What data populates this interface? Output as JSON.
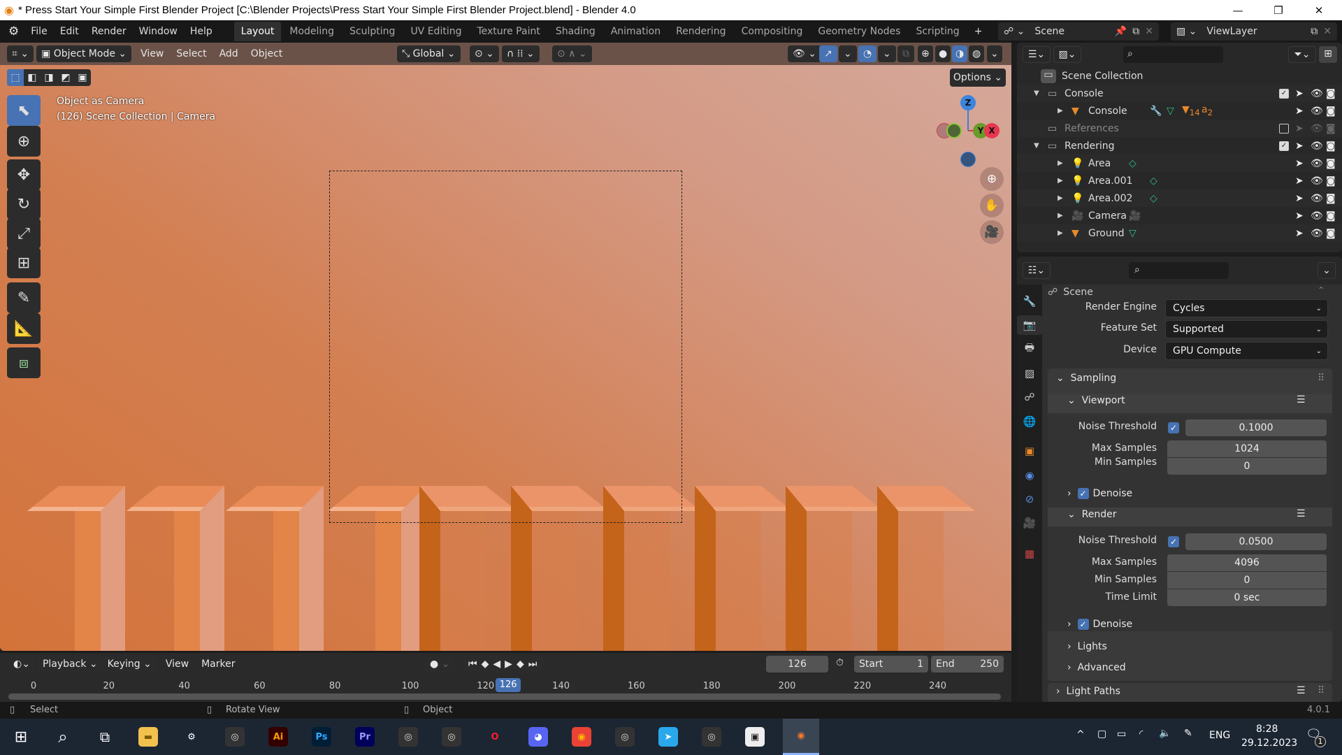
{
  "window": {
    "title": "* Press Start Your Simple First Blender Project [C:\\Blender Projects\\Press Start Your Simple First Blender Project.blend] - Blender 4.0",
    "controls": [
      "minimize",
      "maximize",
      "close"
    ]
  },
  "menus": [
    "File",
    "Edit",
    "Render",
    "Window",
    "Help"
  ],
  "workspaces": [
    "Layout",
    "Modeling",
    "Sculpting",
    "UV Editing",
    "Texture Paint",
    "Shading",
    "Animation",
    "Rendering",
    "Compositing",
    "Geometry Nodes",
    "Scripting"
  ],
  "active_workspace": "Layout",
  "scene": {
    "name": "Scene",
    "view_layer": "ViewLayer"
  },
  "viewport_header": {
    "mode": "Object Mode",
    "menus": [
      "View",
      "Select",
      "Add",
      "Object"
    ],
    "orientation": "Global",
    "options_label": "Options"
  },
  "viewport": {
    "overlay_line1": "Object as Camera",
    "overlay_line2": "(126) Scene Collection | Camera",
    "gizmo": {
      "x": "X",
      "y": "Y",
      "z": "Z"
    },
    "accent": "#4772b3"
  },
  "tools": [
    "select-box",
    "cursor",
    "move",
    "rotate",
    "scale",
    "transform",
    "annotate",
    "measure",
    "add-cube"
  ],
  "outliner": {
    "root": "Scene Collection",
    "rows": [
      {
        "name": "Console",
        "type": "collection",
        "expanded": true,
        "checked": true
      },
      {
        "name": "Console",
        "type": "mesh",
        "badge1": "14",
        "badge2": "2"
      },
      {
        "name": "References",
        "type": "collection",
        "checked": false,
        "disabled": true
      },
      {
        "name": "Rendering",
        "type": "collection",
        "expanded": true,
        "checked": true
      },
      {
        "name": "Area",
        "type": "light"
      },
      {
        "name": "Area.001",
        "type": "light"
      },
      {
        "name": "Area.002",
        "type": "light"
      },
      {
        "name": "Camera",
        "type": "camera"
      },
      {
        "name": "Ground",
        "type": "mesh"
      }
    ]
  },
  "properties": {
    "section_title": "Scene",
    "render_engine": {
      "label": "Render Engine",
      "value": "Cycles"
    },
    "feature_set": {
      "label": "Feature Set",
      "value": "Supported"
    },
    "device": {
      "label": "Device",
      "value": "GPU Compute"
    },
    "sampling": "Sampling",
    "viewport": {
      "title": "Viewport",
      "noise_label": "Noise Threshold",
      "noise": "0.1000",
      "noise_enabled": true,
      "max_label": "Max Samples",
      "max": "1024",
      "min_label": "Min Samples",
      "min": "0",
      "denoise": "Denoise",
      "denoise_enabled": true
    },
    "render": {
      "title": "Render",
      "noise_label": "Noise Threshold",
      "noise": "0.0500",
      "noise_enabled": true,
      "max_label": "Max Samples",
      "max": "4096",
      "min_label": "Min Samples",
      "min": "0",
      "time_label": "Time Limit",
      "time": "0 sec",
      "denoise": "Denoise",
      "denoise_enabled": true
    },
    "lights": "Lights",
    "advanced": "Advanced",
    "light_paths": "Light Paths"
  },
  "timeline": {
    "menus": [
      "Playback",
      "Keying",
      "View",
      "Marker"
    ],
    "current_frame": "126",
    "start_label": "Start",
    "start": "1",
    "end_label": "End",
    "end": "250",
    "ticks": [
      "0",
      "20",
      "40",
      "60",
      "80",
      "100",
      "120",
      "140",
      "160",
      "180",
      "200",
      "220",
      "240"
    ],
    "playhead": 126
  },
  "statusbar": {
    "select": "Select",
    "rotate": "Rotate View",
    "object": "Object",
    "version": "4.0.1"
  },
  "taskbar": {
    "apps": [
      {
        "name": "file-explorer",
        "label": ""
      },
      {
        "name": "steam",
        "label": ""
      },
      {
        "name": "app",
        "label": ""
      },
      {
        "name": "illustrator",
        "label": "Ai"
      },
      {
        "name": "photoshop",
        "label": "Ps"
      },
      {
        "name": "premiere",
        "label": "Pr"
      },
      {
        "name": "app",
        "label": ""
      },
      {
        "name": "app",
        "label": ""
      },
      {
        "name": "opera",
        "label": ""
      },
      {
        "name": "discord",
        "label": ""
      },
      {
        "name": "chrome",
        "label": ""
      },
      {
        "name": "app",
        "label": ""
      },
      {
        "name": "telegram",
        "label": ""
      },
      {
        "name": "app",
        "label": ""
      },
      {
        "name": "twitch",
        "label": ""
      },
      {
        "name": "blender",
        "label": ""
      }
    ],
    "language": "ENG",
    "time": "8:28",
    "date": "29.12.2023",
    "notifications": "1"
  }
}
